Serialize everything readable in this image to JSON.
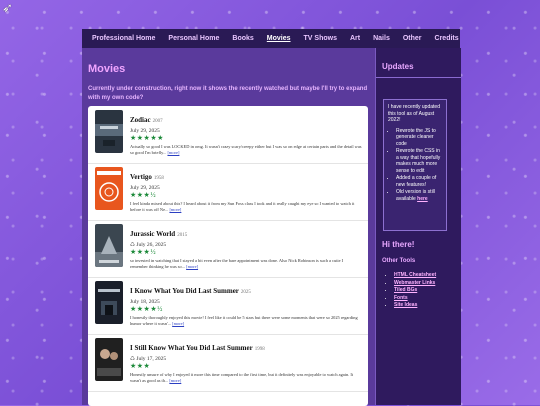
{
  "nav": {
    "items": [
      {
        "label": "Professional Home"
      },
      {
        "label": "Personal Home"
      },
      {
        "label": "Books"
      },
      {
        "label": "Movies",
        "active": true
      },
      {
        "label": "TV Shows"
      },
      {
        "label": "Art"
      },
      {
        "label": "Nails"
      },
      {
        "label": "Other"
      },
      {
        "label": "Credits"
      }
    ]
  },
  "main": {
    "title": "Movies",
    "intro": "Currently under construction, right now it shows the recently watched but maybe I'll try to expand with my own code?",
    "more_label": "[more]",
    "movies": [
      {
        "title": "Zodiac",
        "year": "2007",
        "date": "July 29, 2025",
        "rewatch": false,
        "stars": "★★★★★",
        "review": "Actually so good I was LOCKED in omg. It wasn't crazy scary/creepy either but I was so on edge at certain parts and the detail was so good I'm briefly..."
      },
      {
        "title": "Vertigo",
        "year": "1958",
        "date": "July 29, 2025",
        "rewatch": false,
        "stars": "★★★½",
        "review": "I feel kinda mixed about this? I heard about it from my Sun Foss class I took and it really caught my eye so I wanted to watch it before it was off Ne..."
      },
      {
        "title": "Jurassic World",
        "year": "2015",
        "date": "July 26, 2025",
        "rewatch": true,
        "stars": "★★★½",
        "review": "so invested in watching that I stayed a bit even after the bare appointment was done. Also Nick Robinson is such a cutie I remember thinking he was so..."
      },
      {
        "title": "I Know What You Did Last Summer",
        "year": "2025",
        "date": "July 18, 2025",
        "rewatch": false,
        "stars": "★★★★½",
        "review": "I honestly thoroughly enjoyed this movie! I feel like it could be 5 stars but there were some moments that were so 2025 regarding humor where it wasn'..."
      },
      {
        "title": "I Still Know What You Did Last Summer",
        "year": "1998",
        "date": "July 17, 2025",
        "rewatch": true,
        "stars": "★★★",
        "review": "Honestly unsure of why I enjoyed it more this time compared to the first time, but it definitely was enjoyable to watch again. It wasn't as good as th..."
      }
    ]
  },
  "sidebar": {
    "updates_title": "Updates",
    "updates_intro": "I have recently updated this tool as of August 2022!",
    "updates_items": [
      {
        "text": "Rewrote the JS to generate cleaner code"
      },
      {
        "text": "Rewrote the CSS in a way that hopefully makes much more sense to edit"
      },
      {
        "text": "Added a couple of new features!"
      }
    ],
    "old_version_prefix": "Old version is still available ",
    "old_version_link": "here",
    "hi_title": "Hi there!",
    "other_tools_title": "Other Tools",
    "tools": [
      {
        "label": "HTML Cheatsheet"
      },
      {
        "label": "Webmaster Links"
      },
      {
        "label": "Tiled BGs"
      },
      {
        "label": "Fonts"
      },
      {
        "label": "Site Ideas"
      }
    ]
  },
  "colors": {
    "nav_bg": "#2a1a55",
    "main_bg": "#5a3a9c",
    "sidebar_bg": "#2f1a5e",
    "accent_pink": "#f0a5ff",
    "star_green": "#1d8a3a",
    "link_blue": "#2b3fc2"
  },
  "icons": {
    "cursor": "arrow-cursor-icon",
    "rewatch": "rewatch-icon"
  }
}
